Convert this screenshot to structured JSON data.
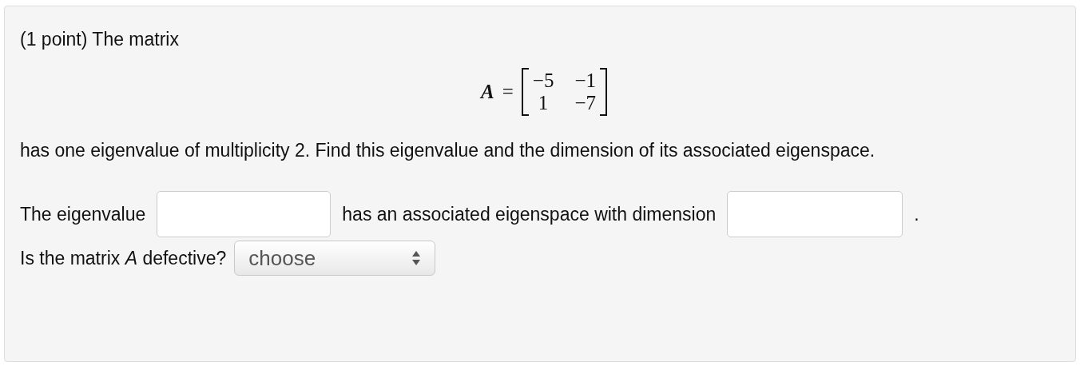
{
  "problem": {
    "intro": "(1 point) The matrix",
    "matrix": {
      "name": "A",
      "equals": "=",
      "rows": [
        [
          "−5",
          "−1"
        ],
        [
          "1",
          "−7"
        ]
      ]
    },
    "statement": "has one eigenvalue of multiplicity 2. Find this eigenvalue and the dimension of its associated eigenspace.",
    "answer_row": {
      "label_before": "The eigenvalue",
      "label_middle": "has an associated eigenspace with dimension",
      "label_after": "."
    },
    "question": {
      "text": "Is the matrix *A* defective?",
      "select_value": "choose"
    }
  }
}
